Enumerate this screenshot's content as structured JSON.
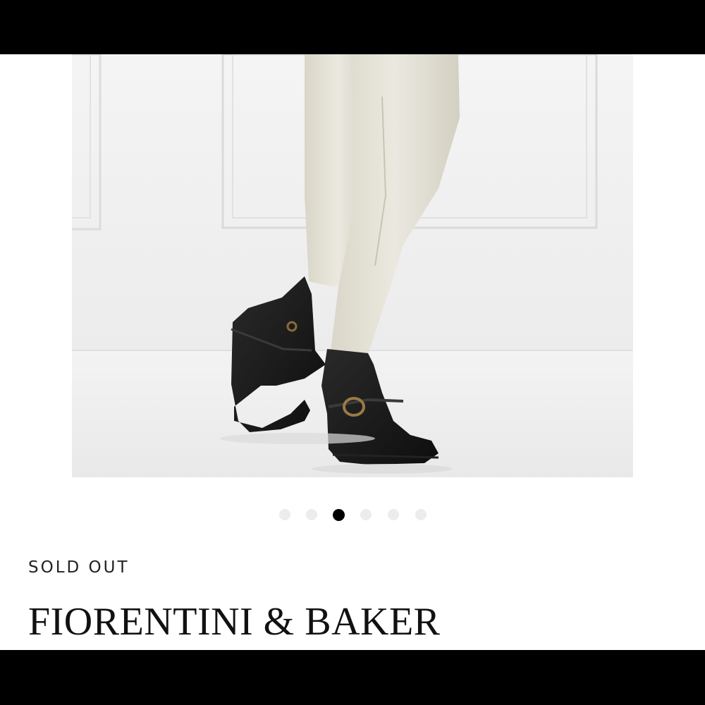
{
  "gallery": {
    "image_alt": "Black leather ankle boots with buckle strap, worn with cream trousers",
    "slide_count": 6,
    "active_index": 2
  },
  "product": {
    "status": "SOLD OUT",
    "brand": "FIORENTINI & BAKER"
  },
  "colors": {
    "dot_inactive": "#ececec",
    "dot_active": "#000000",
    "chrome_bars": "#000000"
  }
}
